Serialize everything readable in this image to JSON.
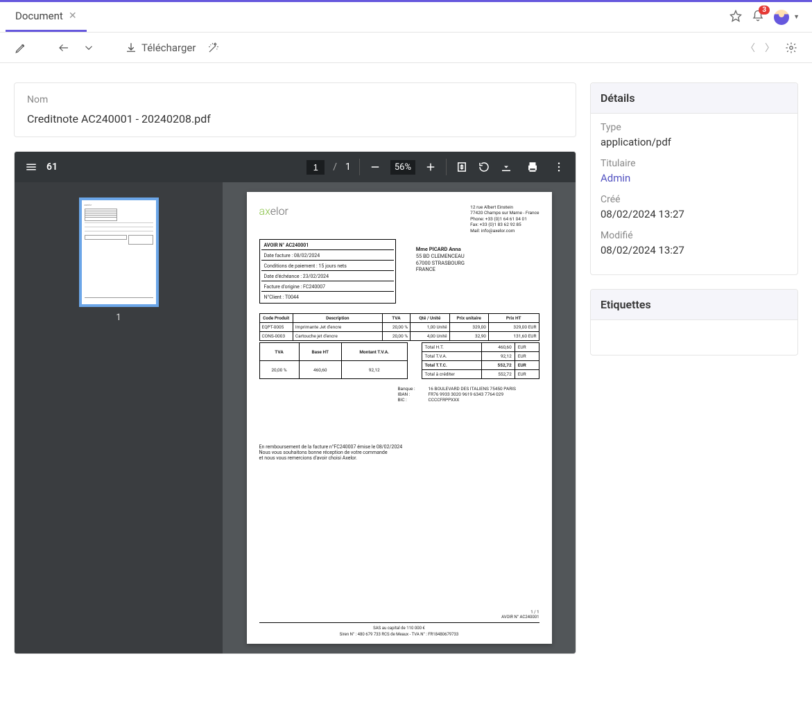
{
  "header": {
    "tab_label": "Document",
    "badge_count": "3"
  },
  "toolbar": {
    "download_label": "Télécharger"
  },
  "name_card": {
    "label": "Nom",
    "value": "Creditnote AC240001 - 20240208.pdf"
  },
  "details": {
    "title": "Détails",
    "type_label": "Type",
    "type_value": "application/pdf",
    "owner_label": "Titulaire",
    "owner_value": "Admin",
    "created_label": "Créé",
    "created_value": "08/02/2024 13:27",
    "modified_label": "Modifié",
    "modified_value": "08/02/2024 13:27"
  },
  "tags": {
    "title": "Etiquettes"
  },
  "pdf": {
    "count": "61",
    "current_page": "1",
    "total_pages": "1",
    "zoom": "56%",
    "thumb_num": "1"
  },
  "doc": {
    "company": {
      "line1": "12 rue Albert Einstein",
      "line2": "77420 Champs sur Marne - France",
      "line3": "Phone: +33 (0)1 64 61 04 01",
      "line4": "Fax: +33 (0)1 83 62 92 85",
      "line5": "Mail: info@axelor.com"
    },
    "meta": {
      "title": "AVOIR N° AC240001",
      "date_facture": "Date facture : 08/02/2024",
      "conditions": "Conditions de paiement : 15 jours nets",
      "echeance": "Date d'échéance : 23/02/2024",
      "facture_orig": "Facture d'origine : FC240007",
      "client": "N°Client : T0044"
    },
    "address": {
      "name": "Mme PICARD Anna",
      "line1": "55 BD CLEMENCEAU",
      "line2": "67000 STRASBOURG",
      "line3": "FRANCE"
    },
    "items_header": {
      "code": "Code Produit",
      "desc": "Description",
      "tva": "TVA",
      "qty": "Qté / Unité",
      "unit_price": "Prix unitaire",
      "price_ht": "Prix HT"
    },
    "items": [
      {
        "code": "EQPT-0005",
        "desc": "Imprimante Jet d'encre",
        "tva": "20,00 %",
        "qty": "1,00 Unité",
        "unit_price": "329,00",
        "price_ht": "329,00 EUR"
      },
      {
        "code": "CONS-0003",
        "desc": "Cartouche jet d'encre",
        "tva": "20,00 %",
        "qty": "4,00 Unité",
        "unit_price": "32,90",
        "price_ht": "131,60 EUR"
      }
    ],
    "tax_header": {
      "tva": "TVA",
      "base": "Base HT",
      "montant": "Montant T.V.A."
    },
    "tax_row": {
      "tva": "20,00 %",
      "base": "460,60",
      "montant": "92,12"
    },
    "totals": {
      "ht_label": "Total H.T.",
      "ht": "460,60",
      "cur1": "EUR",
      "tva_label": "Total T.V.A.",
      "tva": "92,12",
      "cur2": "EUR",
      "ttc_label": "Total T.T.C.",
      "ttc": "552,72",
      "cur3": "EUR",
      "credit_label": "Total à créditer",
      "credit": "552,72",
      "cur4": "EUR"
    },
    "bank": {
      "bank_label": "Banque :",
      "bank": "16 BOULEVARD DES ITALIENS 75450 PARIS",
      "iban_label": "IBAN :",
      "iban": "FR76 9933 3020 9619 6343 7764 029",
      "bic_label": "BIC :",
      "bic": "CCCCFRPPXXX"
    },
    "note1": "En remboursement de la facture n°FC240007  émise le  08/02/2024",
    "note2": "Nous vous souhaitons bonne réception de votre commande",
    "note3": "et nous vous remercions d'avoir choisi Axelor.",
    "footer": {
      "pages": "1  /  1",
      "ref": "AVOIR N°  AC240001",
      "capital": "SAS au capital de 110 000 €",
      "siren": "Siren N° : 480 679 733 RCS de Meaux - TVA N° :  FR18480679733"
    }
  }
}
